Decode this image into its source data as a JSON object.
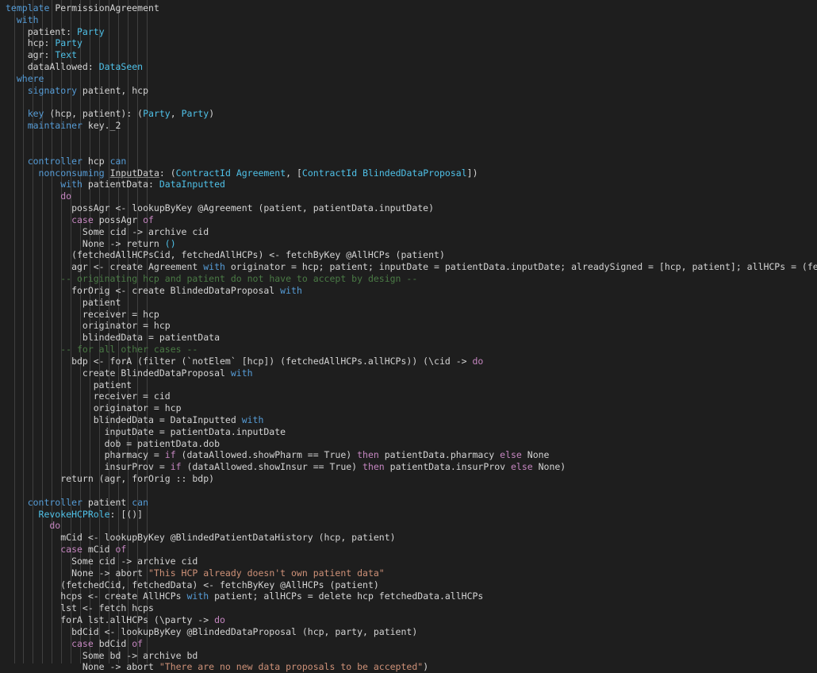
{
  "editor": {
    "language": "daml",
    "theme": "dark",
    "background_color": "#1e1e1e",
    "foreground_color": "#d4d4d4",
    "keyword_color": "#569cd6",
    "control_keyword_color": "#c586c0",
    "type_color": "#4fc1e8",
    "string_color": "#ce9178",
    "comment_color": "#4a7a45",
    "indent_guide_color": "#404040",
    "font_size_px": 11.5,
    "line_height_px": 14.83,
    "total_lines": 56
  },
  "indent_guides_x": [
    18,
    29,
    41,
    53,
    65,
    77,
    89,
    101,
    113,
    125,
    137,
    149,
    161,
    173,
    185
  ],
  "lines": [
    {
      "n": 1,
      "indent": 0,
      "tokens": [
        {
          "t": "template",
          "c": "kw"
        },
        {
          "t": " PermissionAgreement",
          "c": "plain"
        }
      ]
    },
    {
      "n": 2,
      "indent": 2,
      "tokens": [
        {
          "t": "with",
          "c": "kw"
        }
      ]
    },
    {
      "n": 3,
      "indent": 4,
      "tokens": [
        {
          "t": "patient: ",
          "c": "plain"
        },
        {
          "t": "Party",
          "c": "typ"
        }
      ]
    },
    {
      "n": 4,
      "indent": 4,
      "tokens": [
        {
          "t": "hcp: ",
          "c": "plain"
        },
        {
          "t": "Party",
          "c": "typ"
        }
      ]
    },
    {
      "n": 5,
      "indent": 4,
      "tokens": [
        {
          "t": "agr: ",
          "c": "plain"
        },
        {
          "t": "Text",
          "c": "typ"
        }
      ]
    },
    {
      "n": 6,
      "indent": 4,
      "tokens": [
        {
          "t": "dataAllowed: ",
          "c": "plain"
        },
        {
          "t": "DataSeen",
          "c": "typ"
        }
      ]
    },
    {
      "n": 7,
      "indent": 2,
      "tokens": [
        {
          "t": "where",
          "c": "kw"
        }
      ]
    },
    {
      "n": 8,
      "indent": 4,
      "tokens": [
        {
          "t": "signatory",
          "c": "kw"
        },
        {
          "t": " patient, hcp",
          "c": "plain"
        }
      ]
    },
    {
      "n": 9,
      "indent": 0,
      "tokens": []
    },
    {
      "n": 10,
      "indent": 4,
      "tokens": [
        {
          "t": "key",
          "c": "kw"
        },
        {
          "t": " (hcp, patient): (",
          "c": "plain"
        },
        {
          "t": "Party",
          "c": "typ"
        },
        {
          "t": ", ",
          "c": "plain"
        },
        {
          "t": "Party",
          "c": "typ"
        },
        {
          "t": ")",
          "c": "plain"
        }
      ]
    },
    {
      "n": 11,
      "indent": 4,
      "tokens": [
        {
          "t": "maintainer",
          "c": "kw"
        },
        {
          "t": " key._2",
          "c": "plain"
        }
      ]
    },
    {
      "n": 12,
      "indent": 0,
      "tokens": []
    },
    {
      "n": 13,
      "indent": 0,
      "tokens": []
    },
    {
      "n": 14,
      "indent": 4,
      "tokens": [
        {
          "t": "controller",
          "c": "kw"
        },
        {
          "t": " hcp ",
          "c": "plain"
        },
        {
          "t": "can",
          "c": "kw"
        }
      ]
    },
    {
      "n": 15,
      "indent": 6,
      "tokens": [
        {
          "t": "nonconsuming",
          "c": "kw"
        },
        {
          "t": " ",
          "c": "plain"
        },
        {
          "t": "InputData",
          "c": "plain ul"
        },
        {
          "t": ": (",
          "c": "plain"
        },
        {
          "t": "ContractId Agreement",
          "c": "typ"
        },
        {
          "t": ", [",
          "c": "plain"
        },
        {
          "t": "ContractId BlindedDataProposal",
          "c": "typ"
        },
        {
          "t": "])",
          "c": "plain"
        }
      ]
    },
    {
      "n": 16,
      "indent": 10,
      "tokens": [
        {
          "t": "with",
          "c": "kw"
        },
        {
          "t": " patientData: ",
          "c": "plain"
        },
        {
          "t": "DataInputted",
          "c": "typ"
        }
      ]
    },
    {
      "n": 17,
      "indent": 10,
      "tokens": [
        {
          "t": "do",
          "c": "ctl"
        }
      ]
    },
    {
      "n": 18,
      "indent": 12,
      "tokens": [
        {
          "t": "possAgr <- lookupByKey @Agreement (patient, patientData.inputDate)",
          "c": "plain"
        }
      ]
    },
    {
      "n": 19,
      "indent": 12,
      "tokens": [
        {
          "t": "case",
          "c": "ctl"
        },
        {
          "t": " possAgr ",
          "c": "plain"
        },
        {
          "t": "of",
          "c": "ctl"
        }
      ]
    },
    {
      "n": 20,
      "indent": 14,
      "tokens": [
        {
          "t": "Some cid -> archive cid",
          "c": "plain"
        }
      ]
    },
    {
      "n": 21,
      "indent": 14,
      "tokens": [
        {
          "t": "None -> return ",
          "c": "plain"
        },
        {
          "t": "()",
          "c": "typ"
        }
      ]
    },
    {
      "n": 22,
      "indent": 12,
      "tokens": [
        {
          "t": "(fetchedAllHCPsCid, fetchedAllHCPs) <- fetchByKey @AllHCPs (patient)",
          "c": "plain"
        }
      ]
    },
    {
      "n": 23,
      "indent": 12,
      "tokens": [
        {
          "t": "agr <- create Agreement ",
          "c": "plain"
        },
        {
          "t": "with",
          "c": "kw"
        },
        {
          "t": " originator = hcp; patient; inputDate = patientData.inputDate; alreadySigned = [hcp, patient]; allHCPs = (fetchedAllHCPs.allHCPs)",
          "c": "plain"
        }
      ]
    },
    {
      "n": 24,
      "indent": 10,
      "tokens": [
        {
          "t": "-- originating hcp and patient do not have to accept by design --",
          "c": "cmt"
        }
      ]
    },
    {
      "n": 25,
      "indent": 12,
      "tokens": [
        {
          "t": "forOrig <- create BlindedDataProposal ",
          "c": "plain"
        },
        {
          "t": "with",
          "c": "kw"
        }
      ]
    },
    {
      "n": 26,
      "indent": 14,
      "tokens": [
        {
          "t": "patient",
          "c": "plain"
        }
      ]
    },
    {
      "n": 27,
      "indent": 14,
      "tokens": [
        {
          "t": "receiver = hcp",
          "c": "plain"
        }
      ]
    },
    {
      "n": 28,
      "indent": 14,
      "tokens": [
        {
          "t": "originator = hcp",
          "c": "plain"
        }
      ]
    },
    {
      "n": 29,
      "indent": 14,
      "tokens": [
        {
          "t": "blindedData = patientData",
          "c": "plain"
        }
      ]
    },
    {
      "n": 30,
      "indent": 10,
      "tokens": [
        {
          "t": "-- for all other cases --",
          "c": "cmt"
        }
      ]
    },
    {
      "n": 31,
      "indent": 12,
      "tokens": [
        {
          "t": "bdp <- forA (filter (`notElem` [hcp]) (fetchedAllHCPs.allHCPs)) (\\cid -> ",
          "c": "plain"
        },
        {
          "t": "do",
          "c": "ctl"
        }
      ]
    },
    {
      "n": 32,
      "indent": 14,
      "tokens": [
        {
          "t": "create BlindedDataProposal ",
          "c": "plain"
        },
        {
          "t": "with",
          "c": "kw"
        }
      ]
    },
    {
      "n": 33,
      "indent": 16,
      "tokens": [
        {
          "t": "patient",
          "c": "plain"
        }
      ]
    },
    {
      "n": 34,
      "indent": 16,
      "tokens": [
        {
          "t": "receiver = cid",
          "c": "plain"
        }
      ]
    },
    {
      "n": 35,
      "indent": 16,
      "tokens": [
        {
          "t": "originator = hcp",
          "c": "plain"
        }
      ]
    },
    {
      "n": 36,
      "indent": 16,
      "tokens": [
        {
          "t": "blindedData = DataInputted ",
          "c": "plain"
        },
        {
          "t": "with",
          "c": "kw"
        }
      ]
    },
    {
      "n": 37,
      "indent": 18,
      "tokens": [
        {
          "t": "inputDate = patientData.inputDate",
          "c": "plain"
        }
      ]
    },
    {
      "n": 38,
      "indent": 18,
      "tokens": [
        {
          "t": "dob = patientData.dob",
          "c": "plain"
        }
      ]
    },
    {
      "n": 39,
      "indent": 18,
      "tokens": [
        {
          "t": "pharmacy = ",
          "c": "plain"
        },
        {
          "t": "if",
          "c": "ctl"
        },
        {
          "t": " (dataAllowed.showPharm == True) ",
          "c": "plain"
        },
        {
          "t": "then",
          "c": "ctl"
        },
        {
          "t": " patientData.pharmacy ",
          "c": "plain"
        },
        {
          "t": "else",
          "c": "ctl"
        },
        {
          "t": " None",
          "c": "plain"
        }
      ]
    },
    {
      "n": 40,
      "indent": 18,
      "tokens": [
        {
          "t": "insurProv = ",
          "c": "plain"
        },
        {
          "t": "if",
          "c": "ctl"
        },
        {
          "t": " (dataAllowed.showInsur == True) ",
          "c": "plain"
        },
        {
          "t": "then",
          "c": "ctl"
        },
        {
          "t": " patientData.insurProv ",
          "c": "plain"
        },
        {
          "t": "else",
          "c": "ctl"
        },
        {
          "t": " None)",
          "c": "plain"
        }
      ]
    },
    {
      "n": 41,
      "indent": 10,
      "tokens": [
        {
          "t": "return (agr, forOrig :: bdp)",
          "c": "plain"
        }
      ]
    },
    {
      "n": 42,
      "indent": 0,
      "tokens": []
    },
    {
      "n": 43,
      "indent": 4,
      "tokens": [
        {
          "t": "controller",
          "c": "kw"
        },
        {
          "t": " patient ",
          "c": "plain"
        },
        {
          "t": "can",
          "c": "kw"
        }
      ]
    },
    {
      "n": 44,
      "indent": 6,
      "tokens": [
        {
          "t": "RevokeHCPRole",
          "c": "choice"
        },
        {
          "t": ": [()]",
          "c": "plain"
        }
      ]
    },
    {
      "n": 45,
      "indent": 8,
      "tokens": [
        {
          "t": "do",
          "c": "ctl"
        }
      ]
    },
    {
      "n": 46,
      "indent": 10,
      "tokens": [
        {
          "t": "mCid <- lookupByKey @BlindedPatientDataHistory (hcp, patient)",
          "c": "plain"
        }
      ]
    },
    {
      "n": 47,
      "indent": 10,
      "tokens": [
        {
          "t": "case",
          "c": "ctl"
        },
        {
          "t": " mCid ",
          "c": "plain"
        },
        {
          "t": "of",
          "c": "ctl"
        }
      ]
    },
    {
      "n": 48,
      "indent": 12,
      "tokens": [
        {
          "t": "Some cid -> archive cid",
          "c": "plain"
        }
      ]
    },
    {
      "n": 49,
      "indent": 12,
      "tokens": [
        {
          "t": "None -> abort ",
          "c": "plain"
        },
        {
          "t": "\"This HCP already doesn't own patient data\"",
          "c": "str"
        }
      ]
    },
    {
      "n": 50,
      "indent": 10,
      "tokens": [
        {
          "t": "(fetchedCid, fetchedData) <- fetchByKey @AllHCPs (patient)",
          "c": "plain"
        }
      ]
    },
    {
      "n": 51,
      "indent": 10,
      "tokens": [
        {
          "t": "hcps <- create AllHCPs ",
          "c": "plain"
        },
        {
          "t": "with",
          "c": "kw"
        },
        {
          "t": " patient; allHCPs = delete hcp fetchedData.allHCPs",
          "c": "plain"
        }
      ]
    },
    {
      "n": 52,
      "indent": 10,
      "tokens": [
        {
          "t": "lst <- fetch hcps",
          "c": "plain"
        }
      ]
    },
    {
      "n": 53,
      "indent": 10,
      "tokens": [
        {
          "t": "forA lst.allHCPs (\\party -> ",
          "c": "plain"
        },
        {
          "t": "do",
          "c": "ctl"
        }
      ]
    },
    {
      "n": 54,
      "indent": 12,
      "tokens": [
        {
          "t": "bdCid <- lookupByKey @BlindedDataProposal (hcp, party, patient)",
          "c": "plain"
        }
      ]
    },
    {
      "n": 55,
      "indent": 12,
      "tokens": [
        {
          "t": "case",
          "c": "ctl"
        },
        {
          "t": " bdCid ",
          "c": "plain"
        },
        {
          "t": "of",
          "c": "ctl"
        }
      ]
    },
    {
      "n": 56,
      "indent": 14,
      "tokens": [
        {
          "t": "Some bd -> archive bd",
          "c": "plain"
        }
      ]
    },
    {
      "n": 57,
      "indent": 14,
      "tokens": [
        {
          "t": "None -> abort ",
          "c": "plain"
        },
        {
          "t": "\"There are no new data proposals to be accepted\"",
          "c": "str"
        },
        {
          "t": ")",
          "c": "plain"
        }
      ]
    }
  ]
}
